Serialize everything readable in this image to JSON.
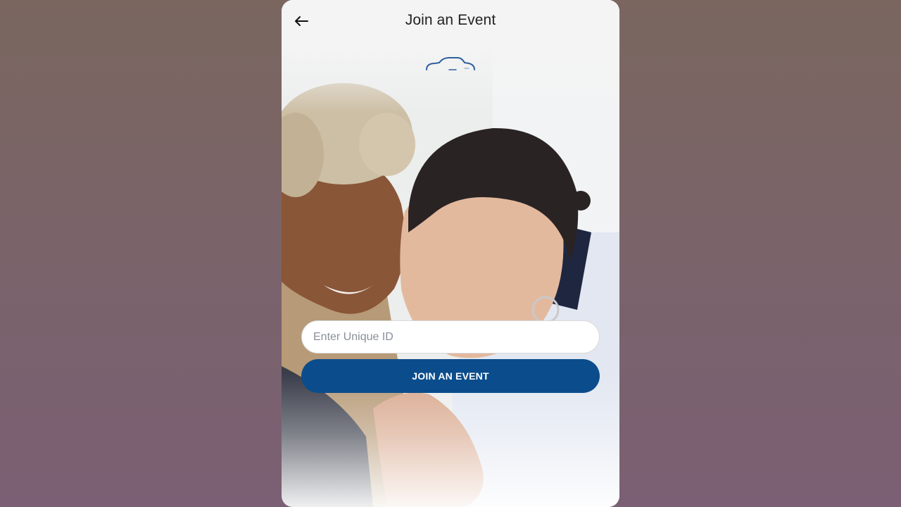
{
  "header": {
    "title": "Join an Event",
    "back_icon": "arrow-left-icon"
  },
  "logo": {
    "icon": "car-outline-icon",
    "color": "#2f5f9e"
  },
  "form": {
    "unique_id_value": "",
    "unique_id_placeholder": "Enter Unique ID",
    "join_button_label": "JOIN AN EVENT"
  },
  "colors": {
    "primary_button": "#0b4d8c",
    "title_text": "#222222",
    "page_background_top": "#7a665f",
    "page_background_bottom": "#7b5f74"
  },
  "background": {
    "hero_image": "two-women-smiling-photo"
  }
}
